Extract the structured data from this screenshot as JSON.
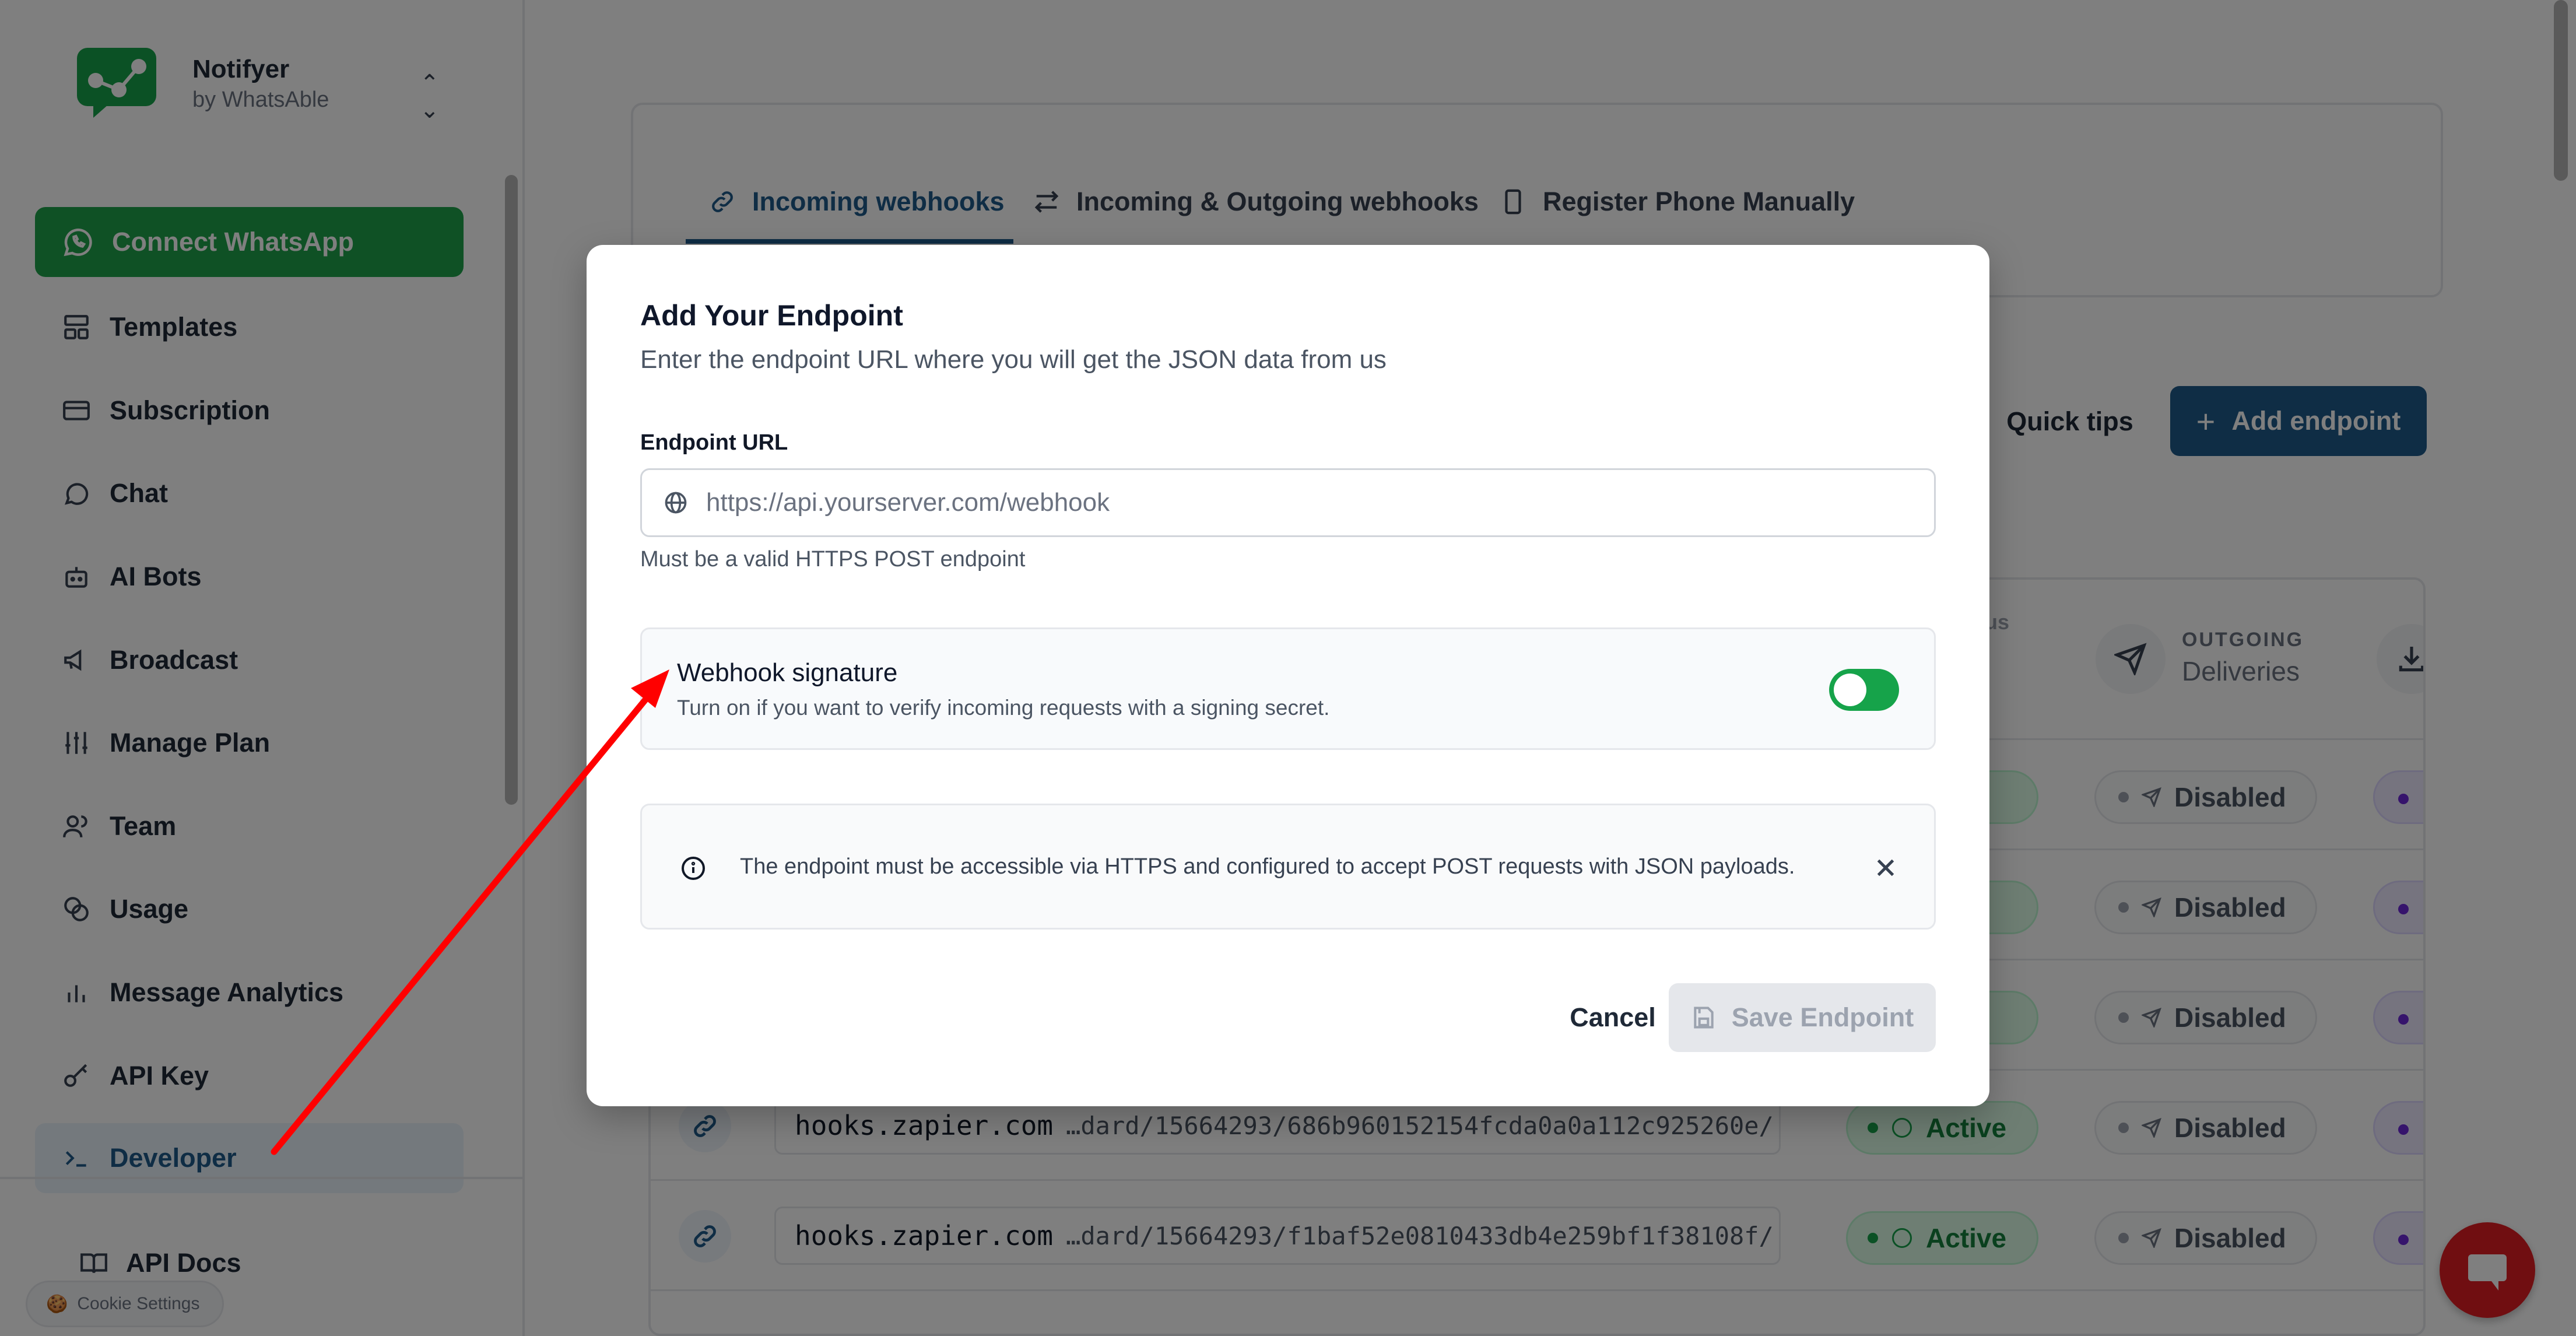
{
  "brand": {
    "name": "Notifyer",
    "subtitle": "by WhatsAble",
    "switch_icon": "chevron-up-down-icon"
  },
  "sidebar": {
    "connect_label": "Connect WhatsApp",
    "items": [
      {
        "label": "Templates",
        "icon": "template-icon"
      },
      {
        "label": "Subscription",
        "icon": "card-icon"
      },
      {
        "label": "Chat",
        "icon": "chat-icon"
      },
      {
        "label": "AI Bots",
        "icon": "bot-icon"
      },
      {
        "label": "Broadcast",
        "icon": "megaphone-icon"
      },
      {
        "label": "Manage Plan",
        "icon": "sliders-icon"
      },
      {
        "label": "Team",
        "icon": "users-icon"
      },
      {
        "label": "Usage",
        "icon": "coins-icon"
      },
      {
        "label": "Message Analytics",
        "icon": "bar-chart-icon"
      },
      {
        "label": "API Key",
        "icon": "key-icon"
      },
      {
        "label": "Developer",
        "icon": "terminal-icon",
        "active": true
      }
    ],
    "api_docs_label": "API Docs"
  },
  "cookie": {
    "label": "Cookie Settings"
  },
  "tabs": [
    {
      "label": "Incoming webhooks",
      "active": true
    },
    {
      "label": "Incoming & Outgoing webhooks"
    },
    {
      "label": "Register Phone Manually"
    }
  ],
  "toolbar": {
    "quick_tips": "Quick tips",
    "add_endpoint": "Add endpoint"
  },
  "table": {
    "header_status_fragment": "us",
    "outgoing_label": "OUTGOING",
    "outgoing_sub": "Deliveries",
    "rows": [
      {
        "domain": "",
        "path": "",
        "status": "ve",
        "outgoing": "Disabled"
      },
      {
        "domain": "",
        "path": "",
        "status": "ve",
        "outgoing": "Disabled"
      },
      {
        "domain": "",
        "path": "",
        "status": "ve",
        "outgoing": "Disabled"
      },
      {
        "domain": "hooks.zapier.com",
        "path": "…dard/15664293/686b960152154fcda0a0a112c925260e/",
        "status": "Active",
        "outgoing": "Disabled"
      },
      {
        "domain": "hooks.zapier.com",
        "path": "…dard/15664293/f1baf52e0810433db4e259bf1f38108f/",
        "status": "Active",
        "outgoing": "Disabled"
      }
    ]
  },
  "modal": {
    "title": "Add Your Endpoint",
    "subtitle": "Enter the endpoint URL where you will get the JSON data from us",
    "endpoint_label": "Endpoint URL",
    "endpoint_placeholder": "https://api.yourserver.com/webhook",
    "endpoint_value": "",
    "endpoint_help": "Must be a valid HTTPS POST endpoint",
    "signature_title": "Webhook signature",
    "signature_desc": "Turn on if you want to verify incoming requests with a signing secret.",
    "signature_enabled": true,
    "info_text": "The endpoint must be accessible via HTTPS and configured to accept POST requests with JSON payloads.",
    "cancel_label": "Cancel",
    "save_label": "Save Endpoint"
  },
  "colors": {
    "brand_blue": "#1e5a8a",
    "whatsapp_green": "#1ea34a",
    "toggle_on": "#16a34a",
    "annotation_red": "#ff0000"
  }
}
